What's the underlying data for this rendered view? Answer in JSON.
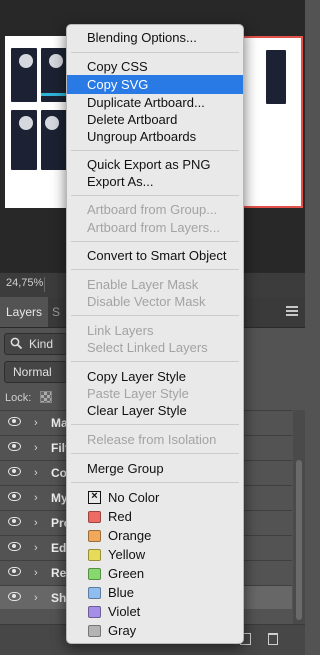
{
  "canvas": {
    "artboard_highlight_color": "#e0524a",
    "zoom": "24,75%"
  },
  "panel": {
    "tab_layers": "Layers",
    "tab_second": "S",
    "kind_label": "Kind",
    "blend_mode": "Normal",
    "lock_label": "Lock:",
    "layers": [
      {
        "name": "Ma",
        "selected": false
      },
      {
        "name": "Filt",
        "selected": false
      },
      {
        "name": "Co",
        "selected": false
      },
      {
        "name": "My",
        "selected": false
      },
      {
        "name": "Pro",
        "selected": false
      },
      {
        "name": "Edi",
        "selected": false
      },
      {
        "name": "Re",
        "selected": false
      },
      {
        "name": "Sh",
        "selected": true
      }
    ]
  },
  "menu": {
    "highlight_color": "#2a7ae6",
    "items": {
      "blending_options": "Blending Options...",
      "copy_css": "Copy CSS",
      "copy_svg": "Copy SVG",
      "duplicate_artboard": "Duplicate Artboard...",
      "delete_artboard": "Delete Artboard",
      "ungroup_artboards": "Ungroup Artboards",
      "quick_export": "Quick Export as PNG",
      "export_as": "Export As...",
      "artboard_from_group": "Artboard from Group...",
      "artboard_from_layers": "Artboard from Layers...",
      "convert_smart_object": "Convert to Smart Object",
      "enable_layer_mask": "Enable Layer Mask",
      "disable_vector_mask": "Disable Vector Mask",
      "link_layers": "Link Layers",
      "select_linked_layers": "Select Linked Layers",
      "copy_layer_style": "Copy Layer Style",
      "paste_layer_style": "Paste Layer Style",
      "clear_layer_style": "Clear Layer Style",
      "release_isolation": "Release from Isolation",
      "merge_group": "Merge Group"
    },
    "colors": [
      {
        "label": "No Color",
        "hex": ""
      },
      {
        "label": "Red",
        "hex": "#ee6b63"
      },
      {
        "label": "Orange",
        "hex": "#f2a85a"
      },
      {
        "label": "Yellow",
        "hex": "#e6dc5a"
      },
      {
        "label": "Green",
        "hex": "#86d96c"
      },
      {
        "label": "Blue",
        "hex": "#8fbdf0"
      },
      {
        "label": "Violet",
        "hex": "#a58ee6"
      },
      {
        "label": "Gray",
        "hex": "#b4b4b4"
      }
    ]
  }
}
